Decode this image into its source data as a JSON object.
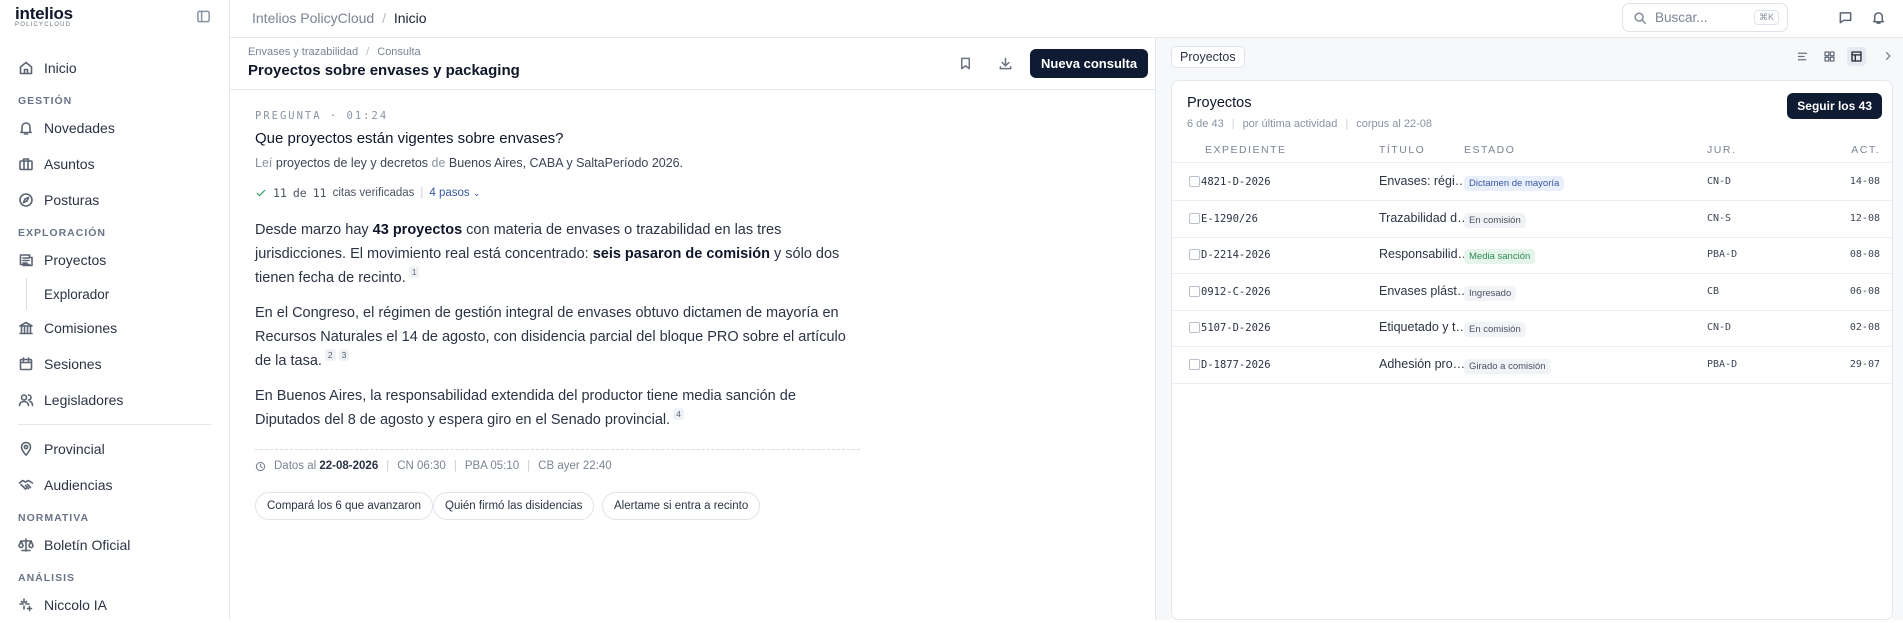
{
  "brand": {
    "name": "intelios",
    "sub": "POLICYCLOUD"
  },
  "sidebar": {
    "home": "Inicio",
    "sections": [
      {
        "title": "GESTIÓN",
        "items": [
          {
            "label": "Novedades",
            "icon": "bell-icon"
          },
          {
            "label": "Asuntos",
            "icon": "briefcase-icon"
          },
          {
            "label": "Posturas",
            "icon": "compass-icon"
          }
        ]
      },
      {
        "title": "EXPLORACIÓN",
        "items": [
          {
            "label": "Proyectos",
            "icon": "document-list-icon"
          },
          {
            "label": "Explorador",
            "icon": ""
          },
          {
            "label": "Comisiones",
            "icon": "building-icon"
          },
          {
            "label": "Sesiones",
            "icon": "calendar-icon"
          },
          {
            "label": "Legisladores",
            "icon": "people-icon"
          }
        ]
      },
      {
        "title": "",
        "items": [
          {
            "label": "Provincial",
            "icon": "pin-icon"
          },
          {
            "label": "Audiencias",
            "icon": "handshake-icon"
          }
        ]
      },
      {
        "title": "NORMATIVA",
        "items": [
          {
            "label": "Boletín Oficial",
            "icon": "scale-icon"
          }
        ]
      },
      {
        "title": "ANÁLISIS",
        "items": [
          {
            "label": "Niccolo IA",
            "icon": "sparkle-icon"
          }
        ]
      }
    ]
  },
  "topbar": {
    "crumb_app": "Intelios PolicyCloud",
    "crumb_sep": "/",
    "crumb_page": "Inicio",
    "search_placeholder": "Buscar...",
    "search_kbd": "⌘K"
  },
  "main": {
    "crumb_1": "Envases y trazabilidad",
    "crumb_sep": "/",
    "crumb_2": "Consulta",
    "title": "Proyectos sobre envases y packaging",
    "new_button": "Nueva consulta",
    "question_label": "PREGUNTA · 01:24",
    "question": "Que proyectos están vigentes sobre envases?",
    "meta_read": "Leí",
    "meta_what": "proyectos de ley y decretos",
    "meta_de": "de",
    "meta_where": "Buenos Aires, CABA y Salta",
    "meta_period": "Período 2026.",
    "verified_a": "11",
    "verified_de": "de",
    "verified_b": "11",
    "verified_text": "citas verificadas",
    "steps": "4 pasos",
    "p1_a": "Desde marzo hay ",
    "p1_b": "43 proyectos",
    "p1_c": " con materia de envases o trazabilidad en las tres jurisdicciones. El movimiento real está concentrado: ",
    "p1_d": "seis pasaron de comisión",
    "p1_e": " y sólo dos tienen fecha de recinto.",
    "p1_cite": "1",
    "p2": "En el Congreso, el régimen de gestión integral de envases obtuvo dictamen de mayoría en Recursos Naturales el 14 de agosto, con disidencia parcial del bloque PRO sobre el artículo de la tasa.",
    "p2_cite_a": "2",
    "p2_cite_b": "3",
    "p3": "En Buenos Aires, la responsabilidad extendida del productor tiene media sanción de Diputados del 8 de agosto y espera giro en el Senado provincial.",
    "p3_cite": "4",
    "data_label": "Datos al",
    "data_date": "22-08-2026",
    "data_cn": "CN 06:30",
    "data_pba": "PBA 05:10",
    "data_cb": "CB ayer 22:40",
    "chips": [
      "Compará los 6 que avanzaron",
      "Quién firmó las disidencias",
      "Alertame si entra a recinto"
    ]
  },
  "right": {
    "tab": "Proyectos",
    "card_title": "Proyectos",
    "count": "6 de 43",
    "order": "por última actividad",
    "corpus": "corpus al 22-08",
    "follow_button": "Seguir los 43",
    "columns": {
      "exp": "EXPEDIENTE",
      "tit": "TÍTULO",
      "est": "ESTADO",
      "jur": "JUR.",
      "act": "ACT."
    },
    "rows": [
      {
        "exp": "4821-D-2026",
        "tit": "Envases: régimen de gestión integral",
        "est": "Dictamen de mayoría",
        "jur": "CN-D",
        "act": "14-08",
        "color": "#3757a6",
        "bg": "#eaf0fb"
      },
      {
        "exp": "E-1290/26",
        "tit": "Trazabilidad de envases",
        "est": "En comisión",
        "jur": "CN-S",
        "act": "12-08",
        "color": "#4b5464",
        "bg": "#f1f3f6"
      },
      {
        "exp": "D-2214-2026",
        "tit": "Responsabilidad extendida del productor",
        "est": "Media sanción",
        "jur": "PBA-D",
        "act": "08-08",
        "color": "#2f8a57",
        "bg": "#e6f5ec"
      },
      {
        "exp": "0912-C-2026",
        "tit": "Envases plásticos",
        "est": "Ingresado",
        "jur": "CB",
        "act": "06-08",
        "color": "#4b5464",
        "bg": "#f1f3f6"
      },
      {
        "exp": "5107-D-2026",
        "tit": "Etiquetado y trazabilidad",
        "est": "En comisión",
        "jur": "CN-D",
        "act": "02-08",
        "color": "#4b5464",
        "bg": "#f1f3f6"
      },
      {
        "exp": "D-1877-2026",
        "tit": "Adhesión provincial",
        "est": "Girado a comisión",
        "jur": "PBA-D",
        "act": "29-07",
        "color": "#4b5464",
        "bg": "#f1f3f6"
      }
    ]
  }
}
